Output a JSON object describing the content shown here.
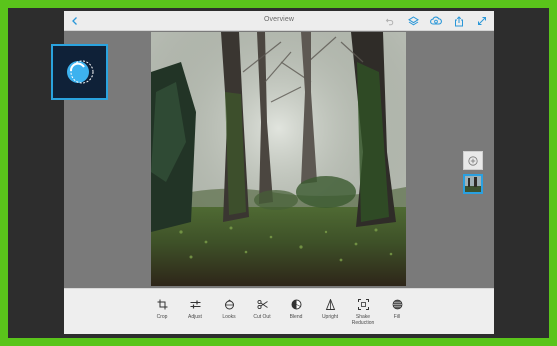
{
  "window": {
    "title": "Overview"
  },
  "toolbar": {
    "tools": [
      {
        "label": "Crop",
        "icon": "crop-icon"
      },
      {
        "label": "Adjust",
        "icon": "adjust-icon"
      },
      {
        "label": "Looks",
        "icon": "looks-icon"
      },
      {
        "label": "Cut Out",
        "icon": "scissors-icon"
      },
      {
        "label": "Blend",
        "icon": "blend-icon"
      },
      {
        "label": "Upright",
        "icon": "upright-icon"
      },
      {
        "label": "Shake Reduction",
        "icon": "shake-reduction-icon"
      },
      {
        "label": "Fill",
        "icon": "fill-icon"
      }
    ]
  },
  "top_icons": [
    "undo-icon",
    "layers-icon",
    "creative-cloud-icon",
    "share-icon",
    "fullscreen-icon"
  ],
  "colors": {
    "frame_accent": "#5ac41b",
    "selection": "#2aa0e0",
    "app_logo_bg": "#0f2138"
  }
}
